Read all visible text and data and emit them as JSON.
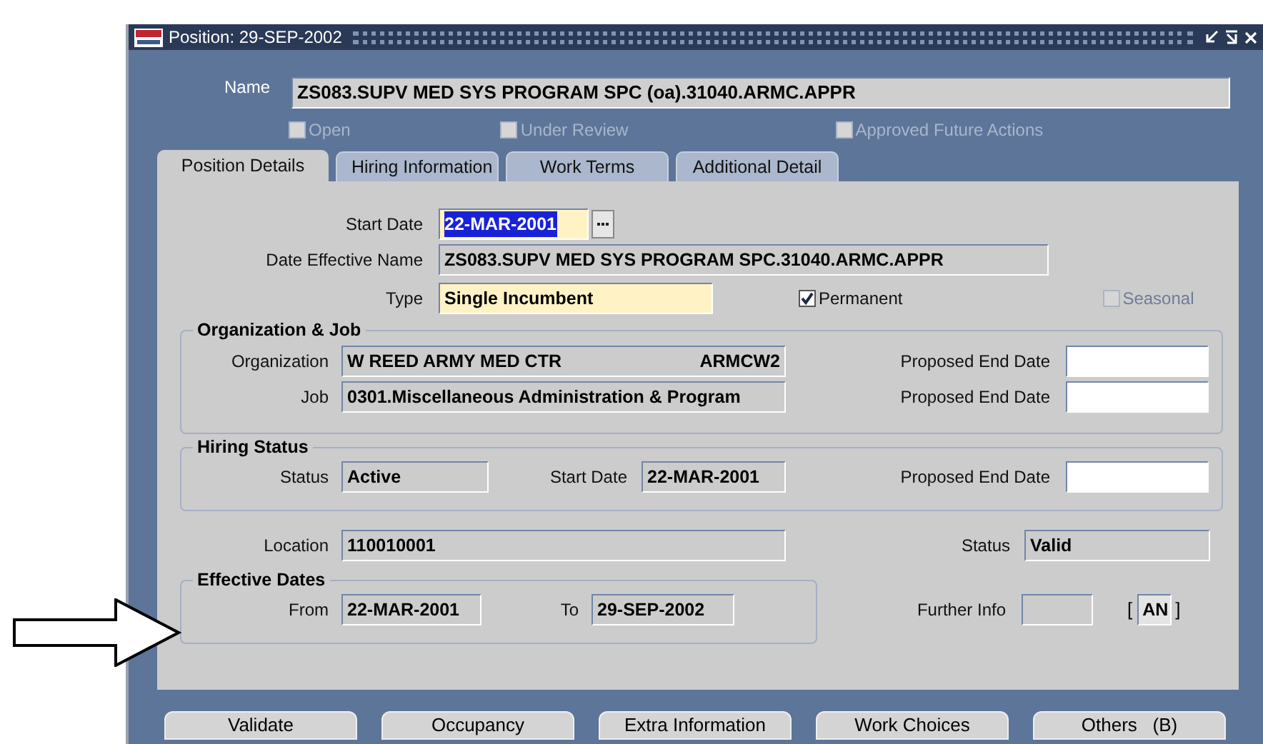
{
  "window": {
    "title": "Position: 29-SEP-2002"
  },
  "name": {
    "label": "Name",
    "value": "ZS083.SUPV MED SYS PROGRAM SPC (oa).31040.ARMC.APPR"
  },
  "flags": [
    {
      "label": "Open",
      "checked": false,
      "disabled": true
    },
    {
      "label": "Under Review",
      "checked": false,
      "disabled": true
    },
    {
      "label": "Approved Future Actions",
      "checked": false,
      "disabled": true
    }
  ],
  "tabs": [
    {
      "label": "Position Details",
      "selected": true
    },
    {
      "label": "Hiring Information",
      "selected": false
    },
    {
      "label": "Work Terms",
      "selected": false
    },
    {
      "label": "Additional Detail",
      "selected": false
    }
  ],
  "details": {
    "start_date": {
      "label": "Start Date",
      "value": "22-MAR-2001",
      "required": true,
      "text_selected": true
    },
    "date_effective_name": {
      "label": "Date Effective Name",
      "value": "ZS083.SUPV MED SYS PROGRAM SPC.31040.ARMC.APPR"
    },
    "type": {
      "label": "Type",
      "value": "Single Incumbent",
      "required": true
    },
    "options": [
      {
        "label": "Permanent",
        "checked": true,
        "disabled": false
      },
      {
        "label": "Seasonal",
        "checked": false,
        "disabled": true
      }
    ]
  },
  "organization_job": {
    "title": "Organization & Job",
    "organization": {
      "label": "Organization",
      "value": "W REED ARMY MED CTR",
      "code": "ARMCW2"
    },
    "job": {
      "label": "Job",
      "value": "0301.Miscellaneous Administration & Program"
    },
    "end_dates": [
      {
        "label": "Proposed End Date",
        "editable": true
      },
      {
        "label": "Proposed End Date",
        "editable": true
      }
    ]
  },
  "hiring_status": {
    "title": "Hiring Status",
    "status": {
      "label": "Status",
      "value": "Active"
    },
    "start_date": {
      "label": "Start Date",
      "value": "22-MAR-2001"
    },
    "end_date": {
      "label": "Proposed End Date",
      "editable": true
    }
  },
  "location": {
    "label": "Location",
    "value": "110010001"
  },
  "status": {
    "label": "Status",
    "value": "Valid"
  },
  "effective_dates": {
    "title": "Effective Dates",
    "from": {
      "label": "From",
      "value": "22-MAR-2001"
    },
    "to": {
      "label": "To",
      "value": "29-SEP-2002"
    }
  },
  "further_info": {
    "label": "Further Info",
    "open_bracket": "[",
    "value": "AN",
    "close_bracket": "]"
  },
  "buttons": [
    "Validate",
    "Occupancy",
    "Extra Information",
    "Work Choices",
    "Others   (B)"
  ]
}
